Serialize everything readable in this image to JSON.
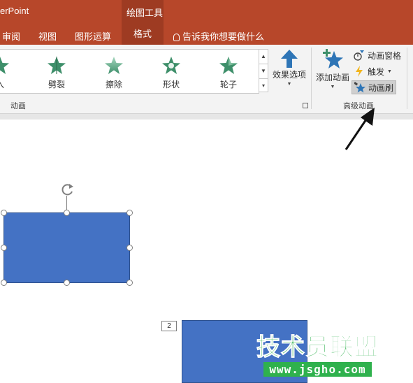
{
  "window": {
    "app_title": "erPoint",
    "tool_group": "绘图工具"
  },
  "tabs": [
    {
      "label": "审阅"
    },
    {
      "label": "视图"
    },
    {
      "label": "图形运算"
    },
    {
      "label": "格式",
      "active": true
    }
  ],
  "tell_me": {
    "label": "告诉我你想要做什么",
    "icon": "lightbulb-icon"
  },
  "ribbon": {
    "animation_gallery": {
      "group_label": "动画",
      "effects": [
        {
          "label": "入",
          "icon": "star-green-icon"
        },
        {
          "label": "劈裂",
          "icon": "star-split-icon"
        },
        {
          "label": "擦除",
          "icon": "star-wipe-icon"
        },
        {
          "label": "形状",
          "icon": "star-shape-icon"
        },
        {
          "label": "轮子",
          "icon": "star-wheel-icon"
        }
      ]
    },
    "effect_options": {
      "label": "效果选项",
      "icon": "up-arrow-icon"
    },
    "advanced": {
      "group_label": "高级动画",
      "add_animation": {
        "label": "添加动画",
        "icon": "add-star-icon"
      },
      "animation_pane": {
        "label": "动画窗格",
        "icon": "animation-pane-icon"
      },
      "trigger": {
        "label": "触发",
        "icon": "lightning-icon"
      },
      "animation_painter": {
        "label": "动画刷",
        "icon": "animation-painter-icon",
        "selected": true
      }
    }
  },
  "slide": {
    "sequence_number": "2"
  },
  "watermark": {
    "title": "技术员联盟",
    "url": "www.jsgho.com"
  },
  "colors": {
    "accent": "#b7472a",
    "shape_fill": "#4472c4",
    "watermark": "#2fb14d"
  }
}
